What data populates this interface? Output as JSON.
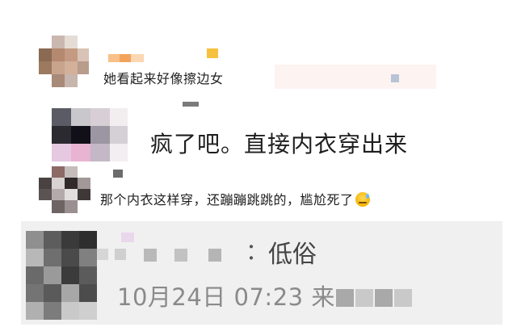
{
  "comments": [
    {
      "text": "她看起来好像擦边女"
    },
    {
      "text": "疯了吧。直接内衣穿出来"
    },
    {
      "text": "那个内衣这样穿，还蹦蹦跳跳的，尴尬死了",
      "emoji": "sweat-smile-emoji"
    }
  ],
  "reply": {
    "separator": "：",
    "text": "低俗",
    "timestamp": "10月24日 07:23",
    "location_prefix": "来"
  },
  "colors": {
    "reply_background": "#f0f0f0",
    "name_highlight": "#f7a641",
    "name_highlight_2": "#f6c13d",
    "username_blur": "#cfcfcf",
    "mosaic_pink": "#e6c8e8"
  }
}
